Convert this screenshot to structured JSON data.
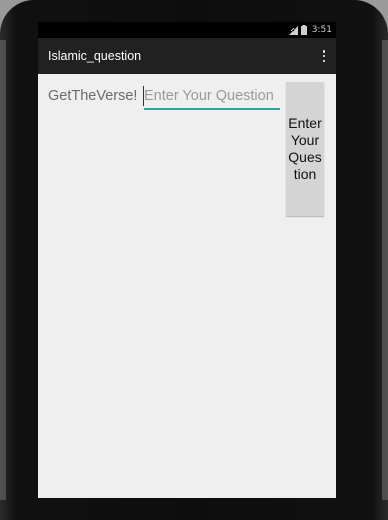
{
  "status_bar": {
    "time": "3:51",
    "signal_icon": "signal-icon",
    "battery_icon": "battery-icon"
  },
  "action_bar": {
    "title": "Islamic_question",
    "overflow_icon": "overflow-menu-icon"
  },
  "main": {
    "label": "GetTheVerse!",
    "question_input": {
      "value": "",
      "placeholder": "Enter Your Question"
    },
    "enter_button_label": "Enter Your Question"
  },
  "colors": {
    "accent": "#2fa7a0",
    "action_bar": "#212121",
    "background": "#efefef"
  }
}
